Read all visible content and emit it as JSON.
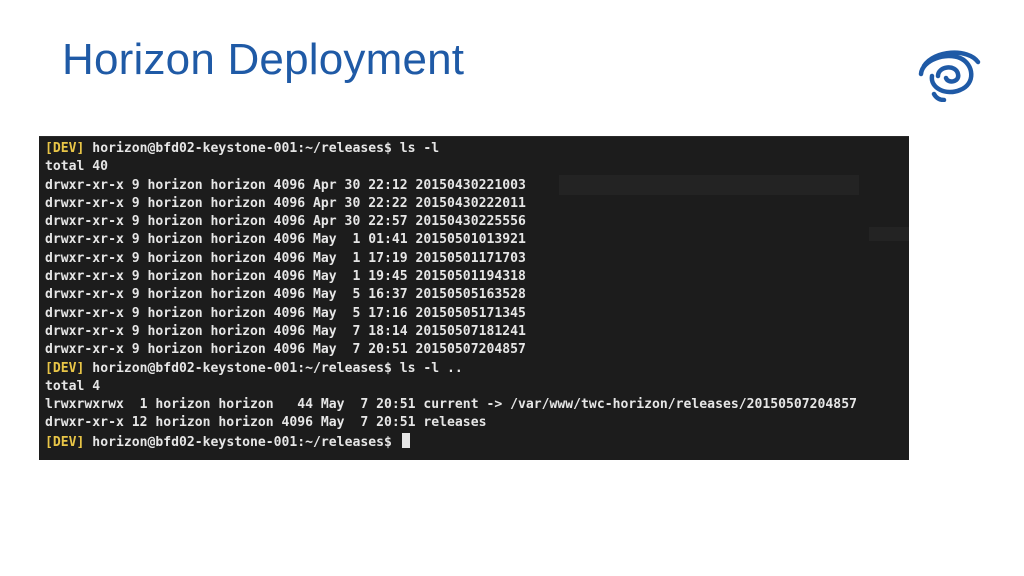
{
  "slide": {
    "title": "Horizon Deployment"
  },
  "colors": {
    "title": "#1f5aa6",
    "logo": "#1f5aa6",
    "terminal_bg": "#1c1c1c",
    "terminal_text": "#e6e6e6",
    "prompt_tag": "#e8c547"
  },
  "logo": {
    "icon": "swirl-eye-logo"
  },
  "terminal": {
    "lines": [
      {
        "tag": "[DEV]",
        "text": " horizon@bfd02-keystone-001:~/releases$ ls -l"
      },
      {
        "tag": "",
        "text": "total 40"
      },
      {
        "tag": "",
        "text": "drwxr-xr-x 9 horizon horizon 4096 Apr 30 22:12 20150430221003"
      },
      {
        "tag": "",
        "text": "drwxr-xr-x 9 horizon horizon 4096 Apr 30 22:22 20150430222011"
      },
      {
        "tag": "",
        "text": "drwxr-xr-x 9 horizon horizon 4096 Apr 30 22:57 20150430225556"
      },
      {
        "tag": "",
        "text": "drwxr-xr-x 9 horizon horizon 4096 May  1 01:41 20150501013921"
      },
      {
        "tag": "",
        "text": "drwxr-xr-x 9 horizon horizon 4096 May  1 17:19 20150501171703"
      },
      {
        "tag": "",
        "text": "drwxr-xr-x 9 horizon horizon 4096 May  1 19:45 20150501194318"
      },
      {
        "tag": "",
        "text": "drwxr-xr-x 9 horizon horizon 4096 May  5 16:37 20150505163528"
      },
      {
        "tag": "",
        "text": "drwxr-xr-x 9 horizon horizon 4096 May  5 17:16 20150505171345"
      },
      {
        "tag": "",
        "text": "drwxr-xr-x 9 horizon horizon 4096 May  7 18:14 20150507181241"
      },
      {
        "tag": "",
        "text": "drwxr-xr-x 9 horizon horizon 4096 May  7 20:51 20150507204857"
      },
      {
        "tag": "[DEV]",
        "text": " horizon@bfd02-keystone-001:~/releases$ ls -l .."
      },
      {
        "tag": "",
        "text": "total 4"
      },
      {
        "tag": "",
        "text": "lrwxrwxrwx  1 horizon horizon   44 May  7 20:51 current -> /var/www/twc-horizon/releases/20150507204857"
      },
      {
        "tag": "",
        "text": "drwxr-xr-x 12 horizon horizon 4096 May  7 20:51 releases"
      },
      {
        "tag": "[DEV]",
        "text": " horizon@bfd02-keystone-001:~/releases$ ",
        "cursor": true
      }
    ]
  }
}
